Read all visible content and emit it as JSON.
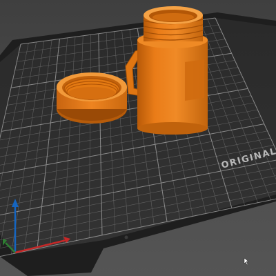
{
  "viewport": {
    "background": "#4a4a4a",
    "bed": {
      "label": "ORIGINAL",
      "surface_color": "#2e2e2e",
      "frame_color": "#1f1f1f",
      "grid_color": "#8a8a8a",
      "label_color": "#b8b8b8"
    },
    "models": [
      {
        "name": "jar-body",
        "color": "#e97b14"
      },
      {
        "name": "jar-lid",
        "color": "#e97b14"
      }
    ],
    "axes": {
      "x_color": "#c62828",
      "y_color": "#2e7d32",
      "z_color": "#1565c0"
    }
  }
}
